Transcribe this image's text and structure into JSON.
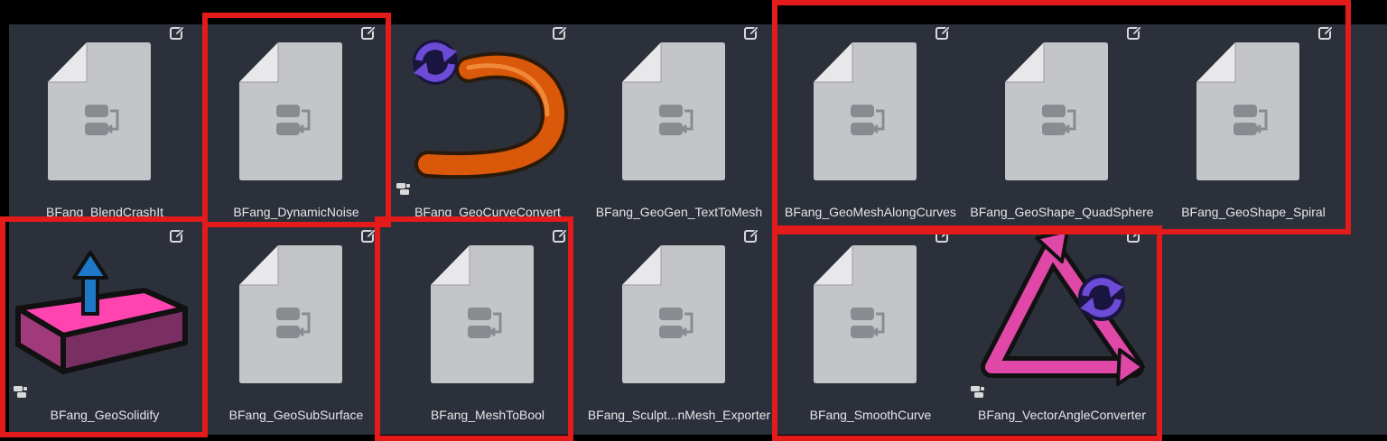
{
  "assets": [
    {
      "name": "BFang_BlendCrashIt",
      "thumbnail": "file-nodetree-icon",
      "linked": false
    },
    {
      "name": "BFang_DynamicNoise",
      "thumbnail": "file-nodetree-icon",
      "linked": false
    },
    {
      "name": "BFang_GeoCurveConvert",
      "thumbnail": "curve-convert-icon",
      "linked": true
    },
    {
      "name": "BFang_GeoGen_TextToMesh",
      "thumbnail": "file-nodetree-icon",
      "linked": false
    },
    {
      "name": "BFang_GeoMeshAlongCurves",
      "thumbnail": "file-nodetree-icon",
      "linked": false
    },
    {
      "name": "BFang_GeoShape_QuadSphere",
      "thumbnail": "file-nodetree-icon",
      "linked": false
    },
    {
      "name": "BFang_GeoShape_Spiral",
      "thumbnail": "file-nodetree-icon",
      "linked": false
    },
    {
      "name": "BFang_GeoSolidify",
      "thumbnail": "solidify-icon",
      "linked": true
    },
    {
      "name": "BFang_GeoSubSurface",
      "thumbnail": "file-nodetree-icon",
      "linked": false
    },
    {
      "name": "BFang_MeshToBool",
      "thumbnail": "file-nodetree-icon",
      "linked": false
    },
    {
      "name": "BFang_Sculpt...nMesh_Exporter",
      "thumbnail": "file-nodetree-icon",
      "linked": false
    },
    {
      "name": "BFang_SmoothCurve",
      "thumbnail": "file-nodetree-icon",
      "linked": false
    },
    {
      "name": "BFang_VectorAngleConverter",
      "thumbnail": "vector-angle-icon",
      "linked": true
    }
  ],
  "colors": {
    "background": "#000000",
    "panel": "#2b303b",
    "label_text": "#e6e6e6",
    "highlight": "#e31b1b",
    "doc_gray": "#c4c5c9"
  }
}
